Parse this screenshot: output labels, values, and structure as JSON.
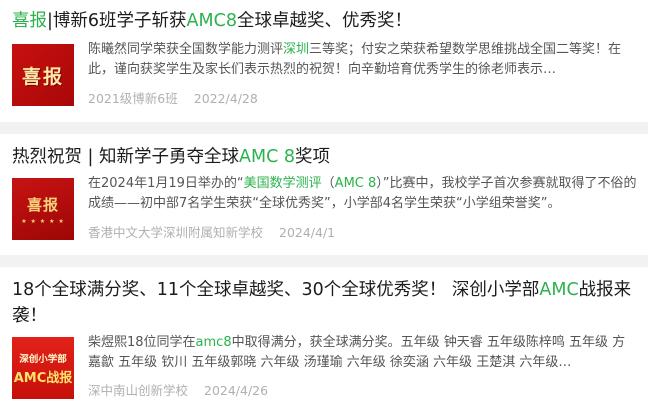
{
  "articles": [
    {
      "title_parts": [
        {
          "text": "喜报",
          "hl": true
        },
        {
          "text": "|博新6班学子斩获",
          "hl": false
        },
        {
          "text": "AMC8",
          "hl": true
        },
        {
          "text": "全球卓越奖、优秀奖！",
          "hl": false
        }
      ],
      "thumb_text": "喜报",
      "snippet_parts": [
        {
          "text": "陈曦然同学荣获全国数学能力测评",
          "hl": false
        },
        {
          "text": "深圳",
          "hl": true
        },
        {
          "text": "三等奖；付安之荣获希望数学思维挑战全国二等奖！在此，谨向获奖学生及家长们表示热烈的祝贺！向辛勤培育优秀学生的徐老师表示…",
          "hl": false
        }
      ],
      "source": "2021级博新6班",
      "date": "2022/4/28"
    },
    {
      "title_parts": [
        {
          "text": "热烈祝贺 | 知新学子勇夺全球",
          "hl": false
        },
        {
          "text": "AMC 8",
          "hl": true
        },
        {
          "text": "奖项",
          "hl": false
        }
      ],
      "thumb_text": "喜报",
      "thumb_stars": "★ ★ ★ ★ ★",
      "snippet_parts": [
        {
          "text": "在2024年1月19日举办的“",
          "hl": false
        },
        {
          "text": "美国数学测评",
          "hl": true
        },
        {
          "text": "（",
          "hl": false
        },
        {
          "text": "AMC 8",
          "hl": true
        },
        {
          "text": "）”比赛中，我校学子首次参赛就取得了不俗的成绩——初中部7名学生荣获“全球优秀奖”，小学部4名学生荣获“小学组荣誉奖”。",
          "hl": false
        }
      ],
      "source": "香港中文大学深圳附属知新学校",
      "date": "2024/4/1"
    },
    {
      "title_parts": [
        {
          "text": "18个全球满分奖、11个全球卓越奖、30个全球优秀奖！ 深创小学部",
          "hl": false
        },
        {
          "text": "AMC",
          "hl": true
        },
        {
          "text": "战报来袭！",
          "hl": false
        }
      ],
      "thumb_line1": "深创小学部",
      "thumb_line2": "AMC战报",
      "snippet_parts": [
        {
          "text": "柴煜熙18位同学在",
          "hl": false
        },
        {
          "text": "amc8",
          "hl": true
        },
        {
          "text": "中取得满分，获全球满分奖。五年级 钟天睿 五年级陈梓鸣 五年级 方嘉歙 五年级 钦川 五年级郭晓 六年级 汤瑾瑜 六年级 徐奕涵 六年级 王楚淇 六年级…",
          "hl": false
        }
      ],
      "source": "深中南山创新学校",
      "date": "2024/4/26"
    }
  ],
  "colors": {
    "highlight": "#2bb24c",
    "thumb_red": "#c81010",
    "meta_gray": "#b0b0b0",
    "divider": "#f2f2f2"
  }
}
